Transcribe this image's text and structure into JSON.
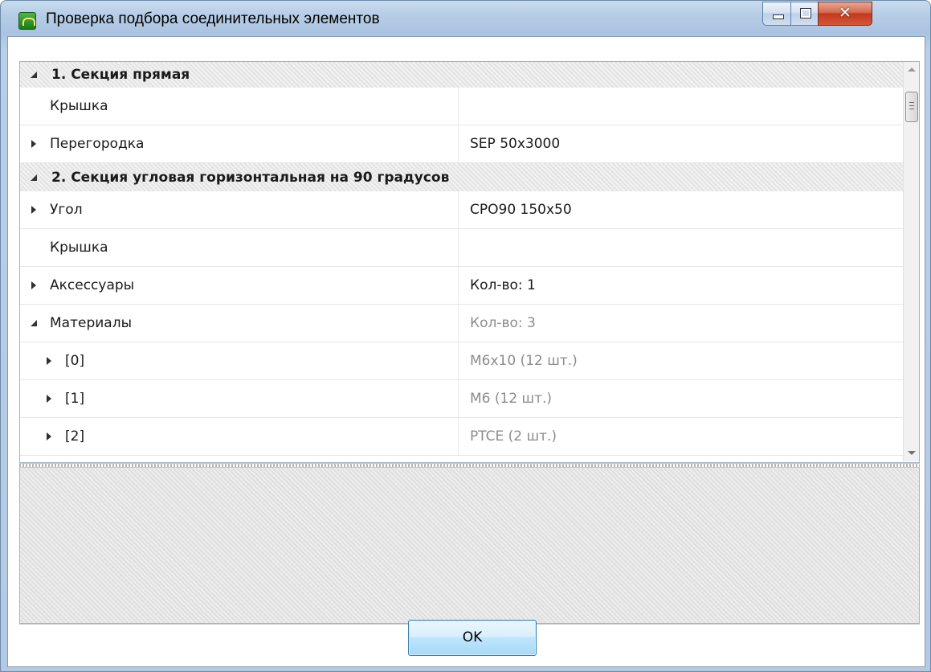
{
  "window": {
    "title": "Проверка подбора соединительных элементов"
  },
  "grid": {
    "rows": [
      {
        "kind": "category",
        "name": "1. Секция прямая",
        "value": "",
        "toggle": "expanded"
      },
      {
        "kind": "property",
        "name": "Крышка",
        "value": "",
        "toggle": "none"
      },
      {
        "kind": "property",
        "name": "Перегородка",
        "value": "SEP 50x3000",
        "toggle": "collapsed"
      },
      {
        "kind": "category",
        "name": "2. Секция угловая горизонтальная на 90 градусов",
        "value": "",
        "toggle": "expanded"
      },
      {
        "kind": "property",
        "name": "Угол",
        "value": "CPO90 150x50",
        "toggle": "collapsed"
      },
      {
        "kind": "property",
        "name": "Крышка",
        "value": "",
        "toggle": "none"
      },
      {
        "kind": "property",
        "name": "Аксессуары",
        "value": "Кол-во: 1",
        "toggle": "collapsed"
      },
      {
        "kind": "property",
        "name": "Материалы",
        "value": "Кол-во: 3",
        "toggle": "expanded",
        "muted": true
      },
      {
        "kind": "child",
        "name": "[0]",
        "value": "M6x10 (12 шт.)",
        "toggle": "collapsed",
        "muted": true
      },
      {
        "kind": "child",
        "name": "[1]",
        "value": "M6 (12 шт.)",
        "toggle": "collapsed",
        "muted": true
      },
      {
        "kind": "child",
        "name": "[2]",
        "value": "PTCE (2 шт.)",
        "toggle": "collapsed",
        "muted": true
      }
    ]
  },
  "footer": {
    "ok_label": "OK"
  }
}
